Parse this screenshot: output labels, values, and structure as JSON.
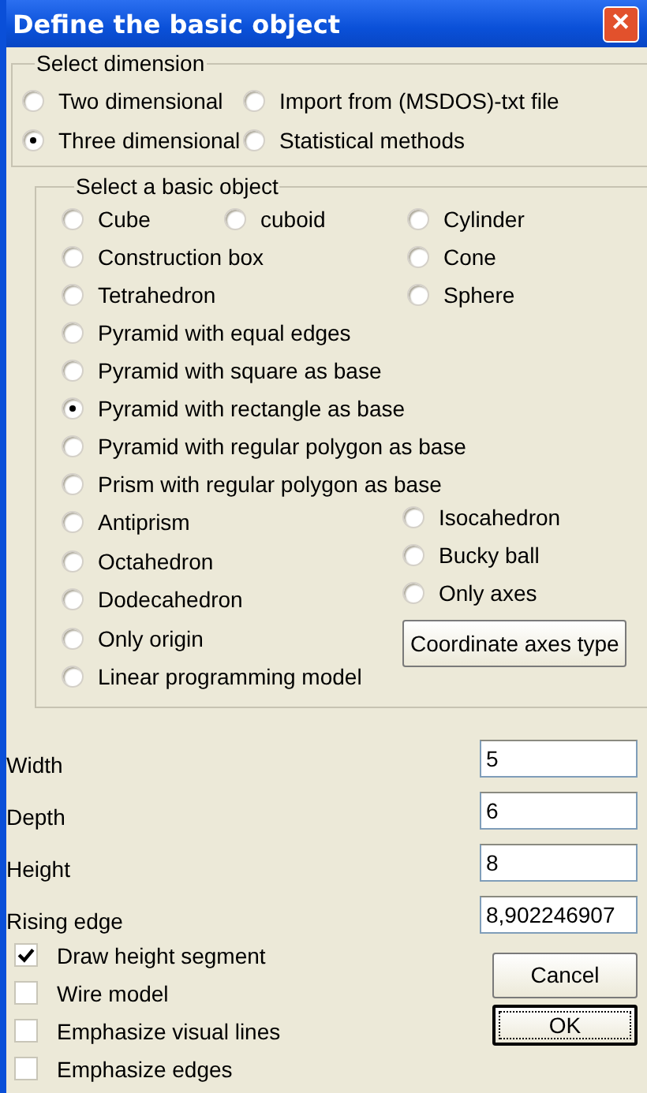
{
  "window": {
    "title": "Define the basic object",
    "close": "✕"
  },
  "dimension": {
    "label": "Select dimension",
    "options": [
      {
        "label": "Two dimensional",
        "selected": false
      },
      {
        "label": "Import from (MSDOS)-txt file",
        "selected": false
      },
      {
        "label": "Three dimensional",
        "selected": true
      },
      {
        "label": "Statistical methods",
        "selected": false
      }
    ]
  },
  "objects": {
    "label": "Select a basic object",
    "grid_rows": [
      [
        {
          "label": "Cube",
          "selected": false
        },
        {
          "label": "cuboid",
          "selected": false
        },
        {
          "label": "Cylinder",
          "selected": false
        }
      ],
      [
        {
          "label": "Construction box",
          "selected": false
        },
        null,
        {
          "label": "Cone",
          "selected": false
        }
      ],
      [
        {
          "label": "Tetrahedron",
          "selected": false
        },
        null,
        {
          "label": "Sphere",
          "selected": false
        }
      ]
    ],
    "full_rows": [
      {
        "label": "Pyramid with equal edges",
        "selected": false
      },
      {
        "label": "Pyramid with square as base",
        "selected": false
      },
      {
        "label": "Pyramid with rectangle as base",
        "selected": true
      },
      {
        "label": "Pyramid with regular polygon as base",
        "selected": false
      },
      {
        "label": "Prism with regular polygon as base",
        "selected": false
      }
    ],
    "left_list": [
      {
        "label": "Antiprism",
        "selected": false
      },
      {
        "label": "Octahedron",
        "selected": false
      },
      {
        "label": "Dodecahedron",
        "selected": false
      },
      {
        "label": "Only origin",
        "selected": false
      },
      {
        "label": "Linear programming model",
        "selected": false
      }
    ],
    "right_list": [
      {
        "label": "Isocahedron",
        "selected": false
      },
      {
        "label": "Bucky ball",
        "selected": false
      },
      {
        "label": "Only axes",
        "selected": false
      }
    ],
    "button": "Coordinate axes type"
  },
  "fields": [
    {
      "label": "Width",
      "value": "5"
    },
    {
      "label": "Depth",
      "value": "6"
    },
    {
      "label": "Height",
      "value": "8"
    },
    {
      "label": "Rising edge",
      "value": "8,902246907"
    }
  ],
  "options": [
    {
      "label": "Draw height segment",
      "checked": true
    },
    {
      "label": "Wire model",
      "checked": false
    },
    {
      "label": "Emphasize visual lines",
      "checked": false
    },
    {
      "label": "Emphasize edges",
      "checked": false
    }
  ],
  "buttons": [
    {
      "label": "Cancel",
      "default": false
    },
    {
      "label": "OK",
      "default": true
    }
  ]
}
